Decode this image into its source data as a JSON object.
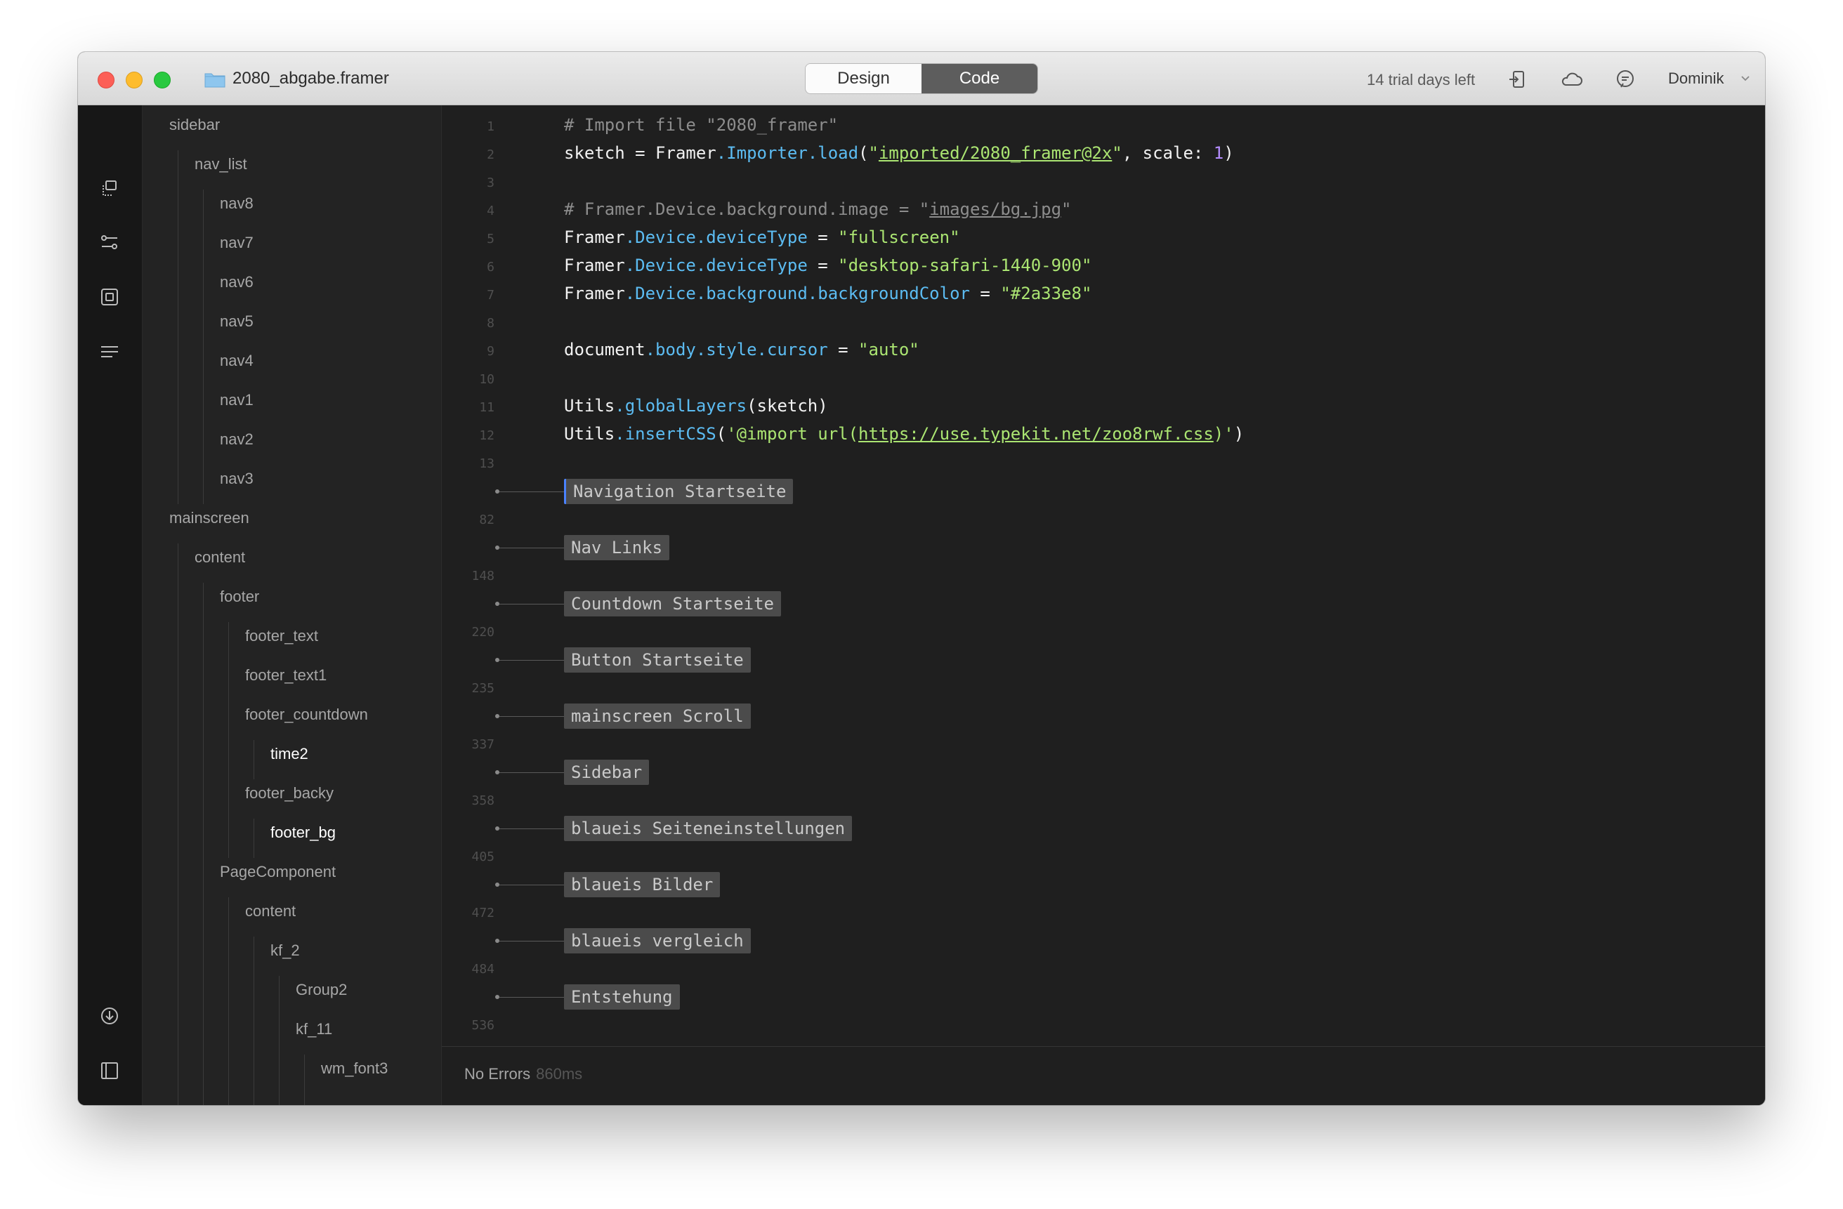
{
  "window": {
    "title": "2080_abgabe.framer",
    "mode_tabs": [
      {
        "label": "Design",
        "active": false
      },
      {
        "label": "Code",
        "active": true
      }
    ],
    "trial_text": "14 trial days left",
    "user_name": "Dominik",
    "toolbar_icons": [
      "export-icon",
      "cloud-icon",
      "comment-icon"
    ]
  },
  "left_toolbar": {
    "top_icons": [
      "layers-icon",
      "properties-icon",
      "component-icon",
      "text-lines-icon"
    ],
    "bottom_icons": [
      "insert-icon",
      "preview-panel-icon",
      "target-icon"
    ]
  },
  "layers": [
    {
      "label": "sidebar",
      "depth": 0
    },
    {
      "label": "nav_list",
      "depth": 1
    },
    {
      "label": "nav8",
      "depth": 2
    },
    {
      "label": "nav7",
      "depth": 2
    },
    {
      "label": "nav6",
      "depth": 2
    },
    {
      "label": "nav5",
      "depth": 2
    },
    {
      "label": "nav4",
      "depth": 2
    },
    {
      "label": "nav1",
      "depth": 2
    },
    {
      "label": "nav2",
      "depth": 2
    },
    {
      "label": "nav3",
      "depth": 2
    },
    {
      "label": "mainscreen",
      "depth": 0
    },
    {
      "label": "content",
      "depth": 1
    },
    {
      "label": "footer",
      "depth": 2
    },
    {
      "label": "footer_text",
      "depth": 3
    },
    {
      "label": "footer_text1",
      "depth": 3
    },
    {
      "label": "footer_countdown",
      "depth": 3
    },
    {
      "label": "time2",
      "depth": 4,
      "selected": true
    },
    {
      "label": "footer_backy",
      "depth": 3
    },
    {
      "label": "footer_bg",
      "depth": 4,
      "selected": true
    },
    {
      "label": "PageComponent",
      "depth": 2
    },
    {
      "label": "content",
      "depth": 3
    },
    {
      "label": "kf_2",
      "depth": 4
    },
    {
      "label": "Group2",
      "depth": 5
    },
    {
      "label": "kf_11",
      "depth": 5
    },
    {
      "label": "wm_font3",
      "depth": 6
    }
  ],
  "code": {
    "line_numbers": [
      "1",
      "2",
      "3",
      "4",
      "5",
      "6",
      "7",
      "8",
      "9",
      "10",
      "11",
      "12",
      "13"
    ],
    "lines": [
      [
        {
          "t": "# Import file \"2080_framer\"",
          "c": "com"
        }
      ],
      [
        {
          "t": "sketch = Framer",
          "c": "id"
        },
        {
          "t": ".Importer.load",
          "c": "prop"
        },
        {
          "t": "(",
          "c": "id"
        },
        {
          "t": "\"",
          "c": "str"
        },
        {
          "t": "imported/2080_framer@2x",
          "c": "str",
          "u": true
        },
        {
          "t": "\"",
          "c": "str"
        },
        {
          "t": ", scale: ",
          "c": "id"
        },
        {
          "t": "1",
          "c": "num"
        },
        {
          "t": ")",
          "c": "id"
        }
      ],
      [],
      [
        {
          "t": "# Framer.Device.background.image = \"",
          "c": "com"
        },
        {
          "t": "images/bg.jpg",
          "c": "com",
          "u": true
        },
        {
          "t": "\"",
          "c": "com"
        }
      ],
      [
        {
          "t": "Framer",
          "c": "id"
        },
        {
          "t": ".Device.deviceType",
          "c": "prop"
        },
        {
          "t": " = ",
          "c": "id"
        },
        {
          "t": "\"fullscreen\"",
          "c": "str"
        }
      ],
      [
        {
          "t": "Framer",
          "c": "id"
        },
        {
          "t": ".Device.deviceType",
          "c": "prop"
        },
        {
          "t": " = ",
          "c": "id"
        },
        {
          "t": "\"desktop-safari-1440-900\"",
          "c": "str"
        }
      ],
      [
        {
          "t": "Framer",
          "c": "id"
        },
        {
          "t": ".Device.background.backgroundColor",
          "c": "prop"
        },
        {
          "t": " = ",
          "c": "id"
        },
        {
          "t": "\"#2a33e8\"",
          "c": "str"
        }
      ],
      [],
      [
        {
          "t": "document",
          "c": "id"
        },
        {
          "t": ".body.style.cursor",
          "c": "prop"
        },
        {
          "t": " = ",
          "c": "id"
        },
        {
          "t": "\"auto\"",
          "c": "str"
        }
      ],
      [],
      [
        {
          "t": "Utils",
          "c": "id"
        },
        {
          "t": ".globalLayers",
          "c": "prop"
        },
        {
          "t": "(sketch)",
          "c": "id"
        }
      ],
      [
        {
          "t": "Utils",
          "c": "id"
        },
        {
          "t": ".insertCSS",
          "c": "prop"
        },
        {
          "t": "(",
          "c": "id"
        },
        {
          "t": "'@import url(",
          "c": "str"
        },
        {
          "t": "https://use.typekit.net/zoo8rwf.css",
          "c": "str",
          "u": true
        },
        {
          "t": ")'",
          "c": "str"
        },
        {
          "t": ")",
          "c": "id"
        }
      ],
      []
    ],
    "folds": [
      {
        "label": "Navigation Startseite",
        "end_line": "82"
      },
      {
        "label": "Nav Links",
        "end_line": "148"
      },
      {
        "label": "Countdown Startseite",
        "end_line": "220"
      },
      {
        "label": "Button Startseite",
        "end_line": "235"
      },
      {
        "label": "mainscreen Scroll",
        "end_line": "337"
      },
      {
        "label": "Sidebar",
        "end_line": "358"
      },
      {
        "label": "blaueis Seiteneinstellungen",
        "end_line": "405"
      },
      {
        "label": "blaueis Bilder",
        "end_line": "472"
      },
      {
        "label": "blaueis vergleich",
        "end_line": "484"
      },
      {
        "label": "Entstehung",
        "end_line": "536"
      }
    ]
  },
  "status": {
    "message": "No Errors",
    "time": "860ms"
  },
  "colors": {
    "editor_bg": "#1f1f1f",
    "string": "#abe572",
    "property": "#5cbcf2",
    "number": "#b48cff",
    "comment": "#8d8d8d"
  }
}
